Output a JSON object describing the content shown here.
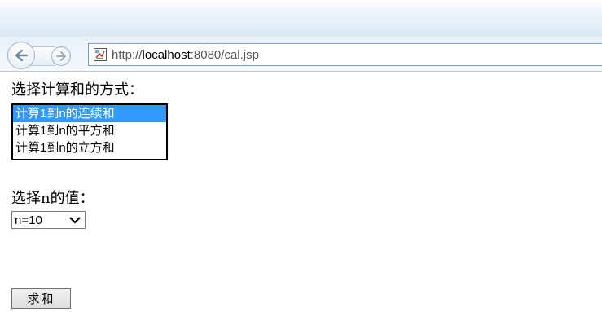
{
  "browser": {
    "url_scheme": "http://",
    "url_host": "localhost",
    "url_rest": ":8080/cal.jsp",
    "icons": {
      "back": "back-arrow-icon",
      "forward": "forward-arrow-icon",
      "favicon": "page-favicon-icon"
    }
  },
  "form": {
    "method_label": "选择计算和的方式：",
    "methods": [
      {
        "label": "计算1到n的连续和",
        "selected": true
      },
      {
        "label": "计算1到n的平方和",
        "selected": false
      },
      {
        "label": "计算1到n的立方和",
        "selected": false
      }
    ],
    "n_label": "选择n的值：",
    "n_selected": "n=10",
    "submit_label": "求和"
  },
  "colors": {
    "selection_bg": "#3399ff",
    "selection_text": "#ffffff"
  }
}
